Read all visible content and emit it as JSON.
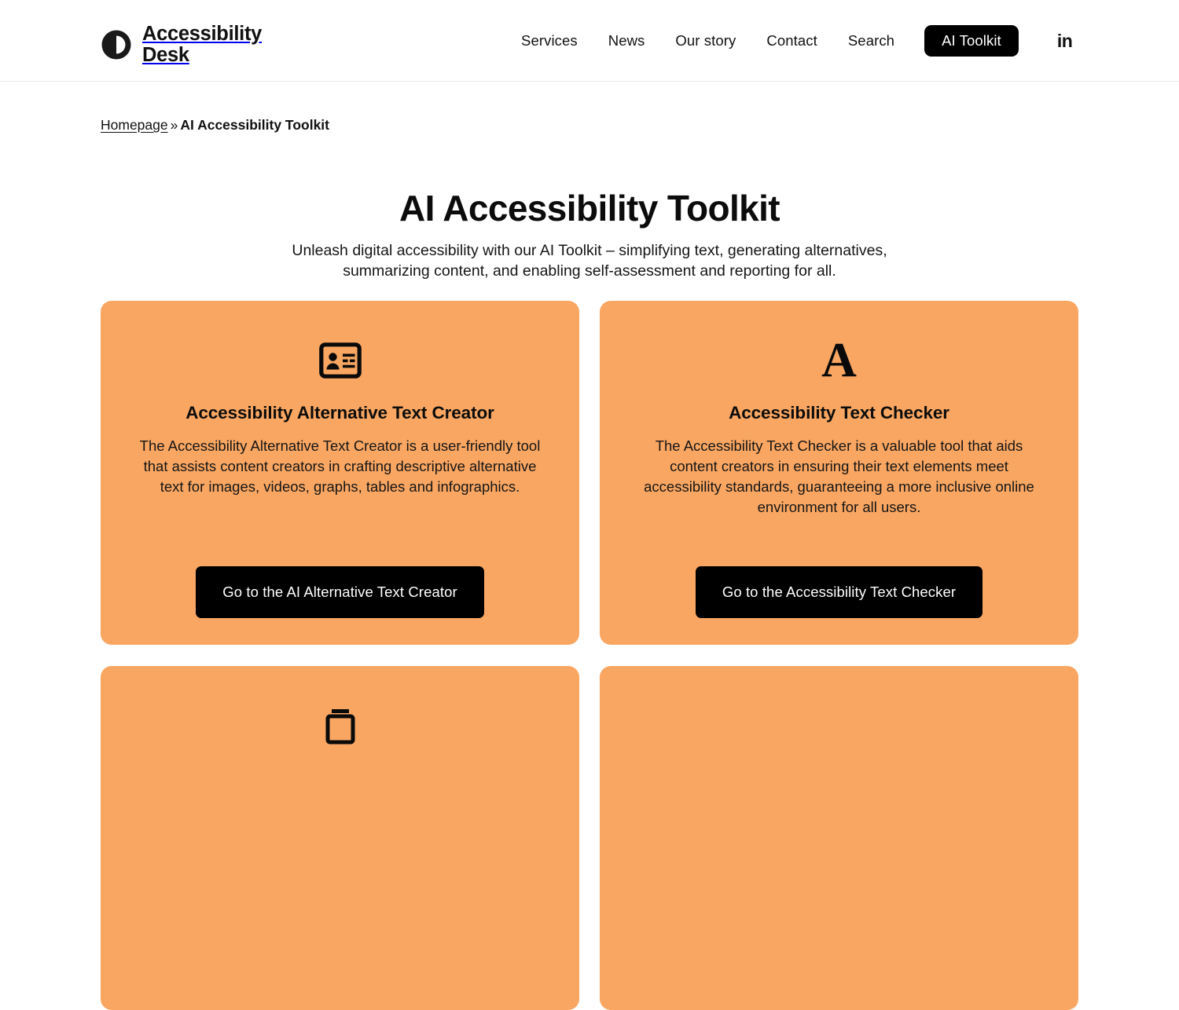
{
  "header": {
    "logo": {
      "icon": "accessibility-desk-logo-icon",
      "wordmark_line1": "Accessibility",
      "wordmark_line2": "Desk"
    },
    "nav": [
      {
        "label": "Services",
        "name": "nav-link-services"
      },
      {
        "label": "News",
        "name": "nav-link-news"
      },
      {
        "label": "Our story",
        "name": "nav-link-our-story"
      },
      {
        "label": "Contact",
        "name": "nav-link-contact"
      },
      {
        "label": "Search",
        "name": "nav-link-search"
      }
    ],
    "cta": {
      "label": "AI Toolkit",
      "bg": "#000000",
      "color": "#ffffff"
    },
    "social": {
      "label": "in",
      "icon": "linkedin-icon"
    }
  },
  "breadcrumb": {
    "home_label": "Homepage",
    "separator": "»",
    "current_label": "AI Accessibility Toolkit"
  },
  "hero": {
    "title": "AI Accessibility Toolkit",
    "subtitle": "Unleash digital accessibility with our AI Toolkit – simplifying text, generating alternatives, summarizing content, and enabling self-assessment and reporting for all."
  },
  "theme": {
    "card_bg": "#f9a662",
    "button_bg": "#000000",
    "text": "#101010",
    "page_bg": "#ffffff",
    "header_border": "#e9e9e9"
  },
  "cards": [
    {
      "icon": "id-card-icon",
      "title": "Accessibility Alternative Text Creator",
      "description": "The Accessibility Alternative Text Creator is a user-friendly tool that assists content creators in crafting descriptive alternative text for images, videos, graphs, tables and infographics.",
      "cta_label": "Go to the AI Alternative Text Creator"
    },
    {
      "icon": "letter-a-icon",
      "title": "Accessibility Text Checker",
      "description": "The Accessibility Text Checker is a valuable tool that aids content creators in ensuring their text elements meet accessibility standards, guaranteeing a more inclusive online environment for all users.",
      "cta_label": "Go to the Accessibility Text Checker"
    },
    {
      "icon": "document-icon",
      "title": "",
      "description": "",
      "cta_label": ""
    },
    {
      "icon": "",
      "title": "",
      "description": "",
      "cta_label": ""
    }
  ]
}
